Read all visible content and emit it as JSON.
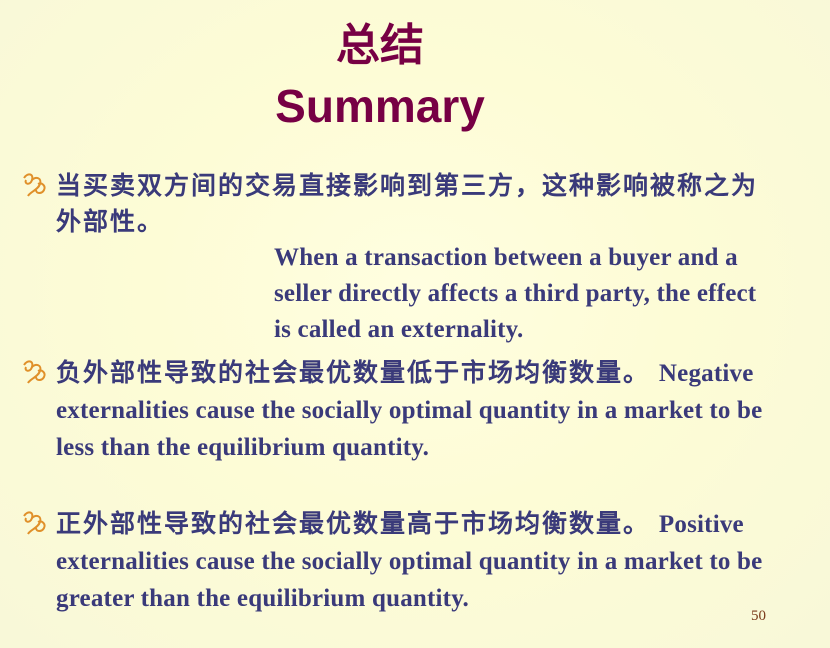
{
  "slide": {
    "title_zh": "总结",
    "title_en": "Summary",
    "page_number": "50",
    "bullet_icon": "fleuron-bullet-icon",
    "colors": {
      "title": "#770044",
      "body": "#3a3a7a",
      "bullet": "#e0902a",
      "page_number": "#7a3a1a"
    }
  },
  "bullets": [
    {
      "zh": "当买卖双方间的交易直接影响到第三方，这种影响被称之为外部性。",
      "en": "When a transaction between a buyer and a seller directly affects a third party, the effect is called an externality."
    },
    {
      "zh": "负外部性导致的社会最优数量低于市场均衡数量。",
      "en": "Negative externalities cause the socially optimal quantity in a market to be less than the equilibrium quantity."
    },
    {
      "zh": "正外部性导致的社会最优数量高于市场均衡数量。",
      "en": "Positive externalities cause the socially optimal quantity in a market to be greater than the equilibrium quantity."
    }
  ]
}
